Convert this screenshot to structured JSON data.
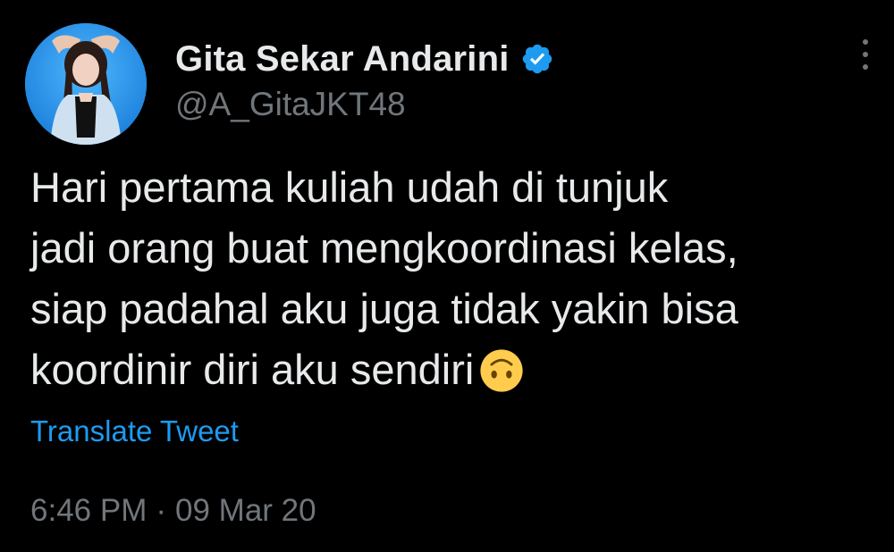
{
  "author": {
    "display_name": "Gita Sekar Andarini",
    "handle": "@A_GitaJKT48",
    "verified": true,
    "avatar_icon": "profile-photo"
  },
  "tweet": {
    "text_lines": [
      "Hari pertama kuliah udah di tunjuk",
      "jadi orang buat mengkoordinasi kelas,",
      "siap padahal aku juga tidak yakin bisa",
      "koordinir diri aku sendiri"
    ],
    "emoji": "upside-down-face"
  },
  "actions": {
    "translate_label": "Translate Tweet",
    "more_icon": "more-vertical-icon"
  },
  "meta": {
    "time": "6:46 PM",
    "separator": "·",
    "date": "09 Mar 20"
  },
  "colors": {
    "background": "#000000",
    "primary_text": "#e7e9ea",
    "secondary_text": "#71767b",
    "accent": "#1d9bf0"
  }
}
